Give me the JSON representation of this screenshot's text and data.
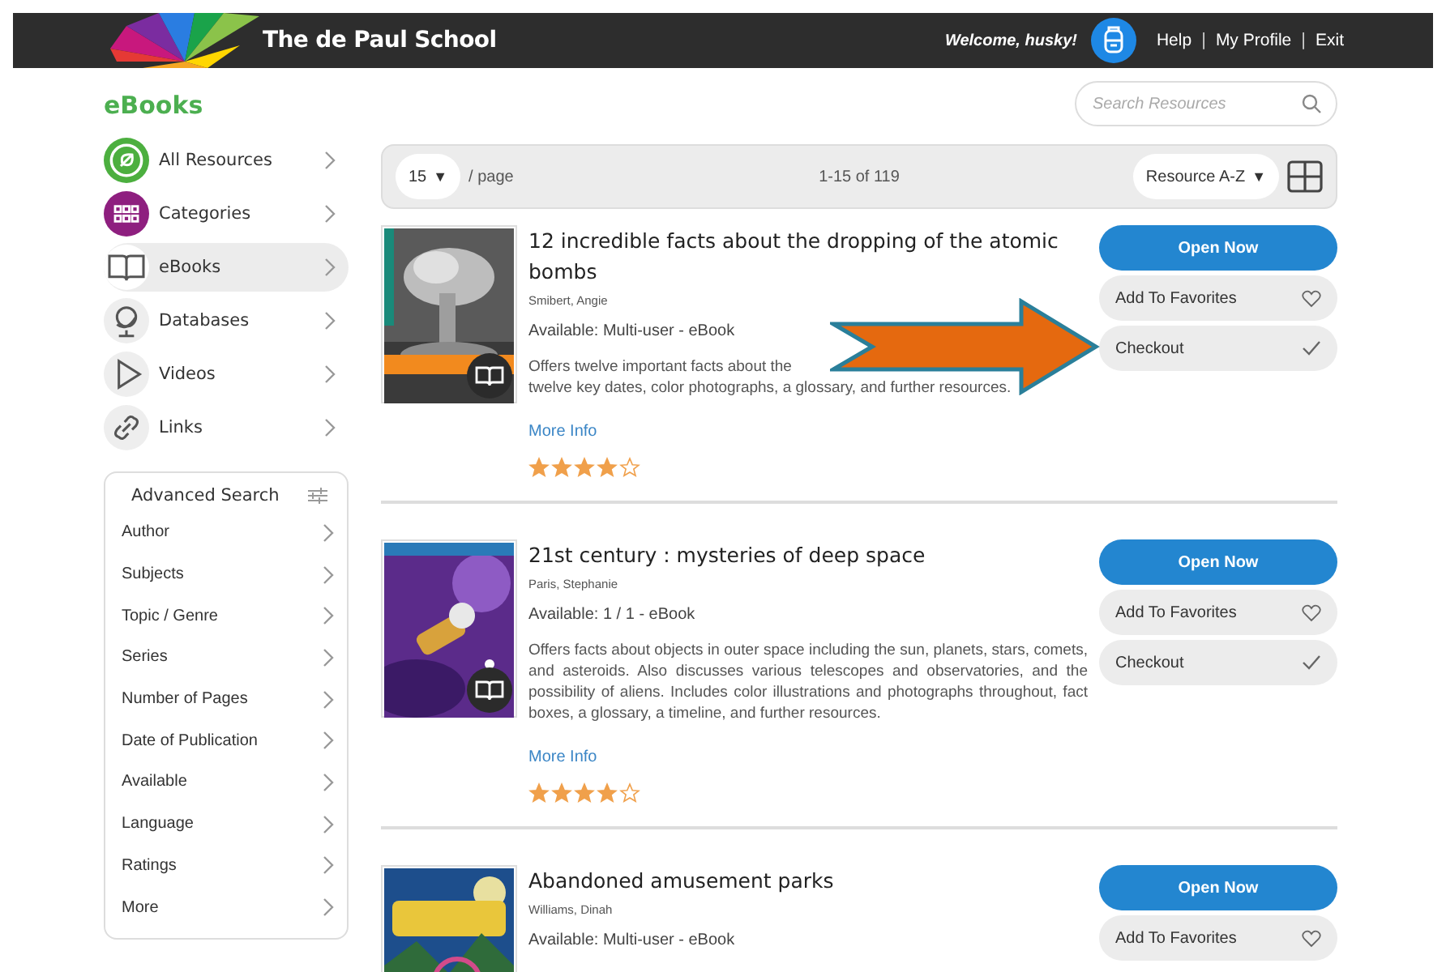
{
  "header": {
    "title": "The de Paul School",
    "welcome": "Welcome, husky!",
    "links": [
      "Help",
      "My Profile",
      "Exit"
    ],
    "separators": [
      "|",
      "|"
    ]
  },
  "page_title": "eBooks",
  "search": {
    "placeholder": "Search Resources"
  },
  "nav": [
    {
      "label": "All Resources",
      "selected": false,
      "color": "#4caf3f"
    },
    {
      "label": "Categories",
      "selected": false,
      "color": "#8e1f7f"
    },
    {
      "label": "eBooks",
      "selected": true,
      "color": "#ffffff"
    },
    {
      "label": "Databases",
      "selected": false,
      "color": "#eeeeee"
    },
    {
      "label": "Videos",
      "selected": false,
      "color": "#eeeeee"
    },
    {
      "label": "Links",
      "selected": false,
      "color": "#eeeeee"
    }
  ],
  "advanced_search": {
    "title": "Advanced Search",
    "filters": [
      "Author",
      "Subjects",
      "Topic / Genre",
      "Series",
      "Number of Pages",
      "Date of Publication",
      "Available",
      "Language",
      "Ratings",
      "More"
    ]
  },
  "toolbar": {
    "per_page": "15",
    "per_page_caret": "▼",
    "per_page_label": "/ page",
    "range": "1-15 of 119",
    "sort": "Resource A-Z",
    "sort_caret": "▼"
  },
  "results": [
    {
      "title": "12 incredible facts about the dropping of the atomic bombs",
      "author": "Smibert, Angie",
      "availability": "Available: Multi-user - eBook",
      "description_lines": [
        "Offers twelve important facts about the",
        "twelve key dates, color photographs, a glossary, and further resources."
      ],
      "more": "More Info",
      "stars": 4,
      "buttons": [
        {
          "label": "Open Now",
          "kind": "primary"
        },
        {
          "label": "Add To Favorites",
          "kind": "favorite"
        },
        {
          "label": "Checkout",
          "kind": "checkout"
        }
      ]
    },
    {
      "title": "21st century : mysteries of deep space",
      "author": "Paris, Stephanie",
      "availability": "Available: 1 / 1 - eBook",
      "description": "Offers facts about objects in outer space including the sun, planets, stars, comets, and asteroids. Also discusses various telescopes and observatories, and the possibility of aliens. Includes color illustrations and photographs throughout, fact boxes, a glossary, a timeline, and further resources.",
      "more": "More Info",
      "stars": 4,
      "buttons": [
        {
          "label": "Open Now",
          "kind": "primary"
        },
        {
          "label": "Add To Favorites",
          "kind": "favorite"
        },
        {
          "label": "Checkout",
          "kind": "checkout"
        }
      ]
    },
    {
      "title": "Abandoned amusement parks",
      "author": "Williams, Dinah",
      "availability": "Available: Multi-user - eBook",
      "buttons": [
        {
          "label": "Open Now",
          "kind": "primary"
        },
        {
          "label": "Add To Favorites",
          "kind": "favorite"
        }
      ]
    }
  ]
}
